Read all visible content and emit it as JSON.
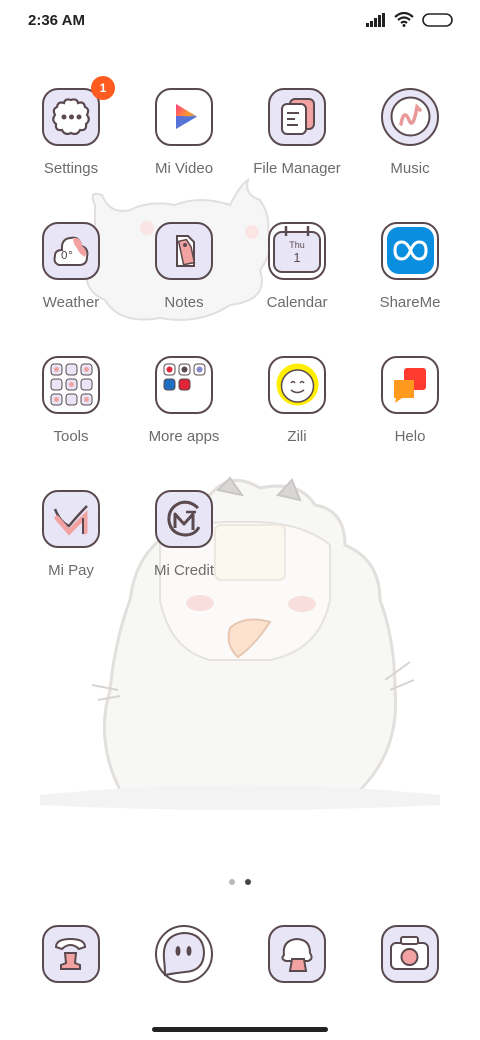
{
  "status_bar": {
    "time": "2:36 AM"
  },
  "apps": [
    {
      "label": "Settings",
      "icon": "settings-icon",
      "badge": "1"
    },
    {
      "label": "Mi Video",
      "icon": "mi-video-icon"
    },
    {
      "label": "File Manager",
      "icon": "file-manager-icon"
    },
    {
      "label": "Music",
      "icon": "music-icon"
    },
    {
      "label": "Weather",
      "icon": "weather-icon",
      "icon_text": "0°"
    },
    {
      "label": "Notes",
      "icon": "notes-icon"
    },
    {
      "label": "Calendar",
      "icon": "calendar-icon",
      "day": "Thu",
      "date": "1"
    },
    {
      "label": "ShareMe",
      "icon": "shareme-icon"
    },
    {
      "label": "Tools",
      "icon": "tools-folder-icon"
    },
    {
      "label": "More apps",
      "icon": "more-apps-folder-icon"
    },
    {
      "label": "Zili",
      "icon": "zili-icon"
    },
    {
      "label": "Helo",
      "icon": "helo-icon"
    },
    {
      "label": "Mi Pay",
      "icon": "mi-pay-icon"
    },
    {
      "label": "Mi Credit",
      "icon": "mi-credit-icon"
    }
  ],
  "pager": {
    "pages": 2,
    "active": 2
  },
  "dock": [
    {
      "icon": "phone-icon"
    },
    {
      "icon": "messages-icon"
    },
    {
      "icon": "browser-icon"
    },
    {
      "icon": "camera-icon"
    }
  ],
  "colors": {
    "icon_bg": "#e8e6f6",
    "outline": "#5a4a4f",
    "badge": "#ff5a1f",
    "accent_pink": "#f3a2a2"
  }
}
